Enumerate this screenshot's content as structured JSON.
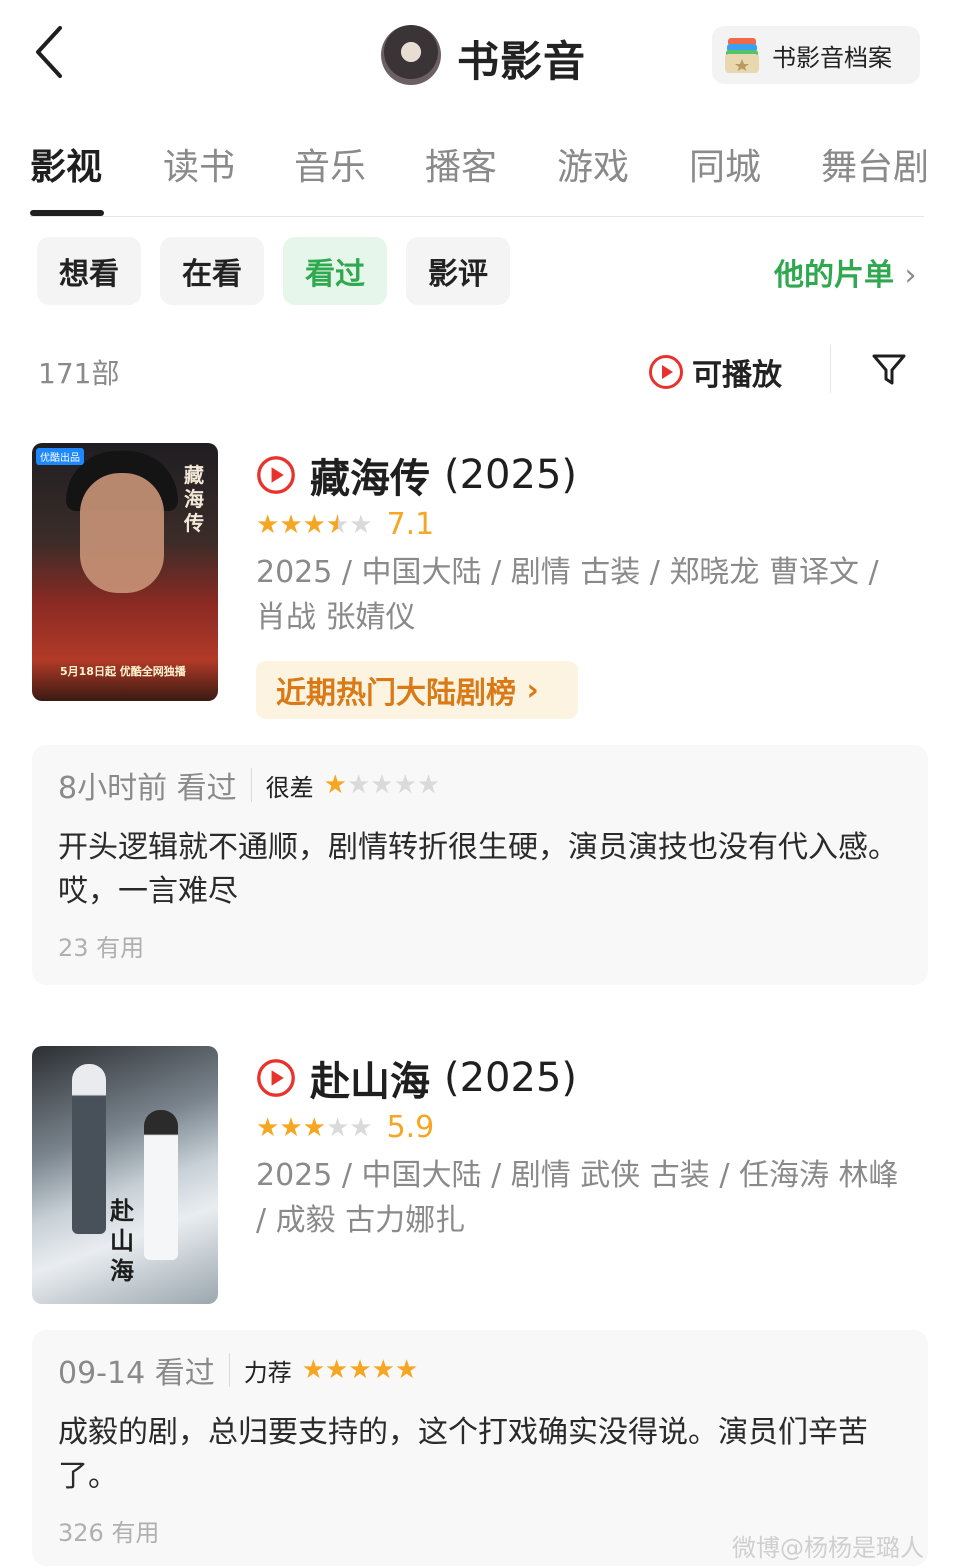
{
  "header": {
    "back_icon": "chevron-left-icon",
    "title": "书影音",
    "archive_button": "书影音档案"
  },
  "tabs": [
    {
      "label": "影视",
      "active": true
    },
    {
      "label": "读书",
      "active": false
    },
    {
      "label": "音乐",
      "active": false
    },
    {
      "label": "播客",
      "active": false
    },
    {
      "label": "游戏",
      "active": false
    },
    {
      "label": "同城",
      "active": false
    },
    {
      "label": "舞台剧",
      "active": false
    }
  ],
  "filters": [
    {
      "label": "想看",
      "active": false
    },
    {
      "label": "在看",
      "active": false
    },
    {
      "label": "看过",
      "active": true
    },
    {
      "label": "影评",
      "active": false
    }
  ],
  "playlist_link": "他的片单",
  "count": "171部",
  "playable_label": "可播放",
  "colors": {
    "accent_green": "#2fa84f",
    "star_orange": "#f5a623",
    "play_red": "#e8332d"
  },
  "movies": [
    {
      "title": "藏海传",
      "year": "(2025)",
      "rating_stars": 3.5,
      "score": "7.1",
      "meta": "2025 / 中国大陆 / 剧情 古装 / 郑晓龙 曹译文 / 肖战 张婧仪",
      "rank_tag": "近期热门大陆剧榜",
      "poster": {
        "badge": "优酷出品",
        "vertical_title": "藏海传",
        "date_text": "5月18日起 优酷全网独播"
      },
      "review": {
        "time": "8小时前 看过",
        "level": "很差",
        "stars": 1,
        "text": "开头逻辑就不通顺，剧情转折很生硬，演员演技也没有代入感。哎，一言难尽",
        "useful": "23 有用"
      }
    },
    {
      "title": "赴山海",
      "year": "(2025)",
      "rating_stars": 3,
      "score": "5.9",
      "meta": "2025 / 中国大陆 / 剧情 武侠 古装 / 任海涛 林峰 / 成毅 古力娜扎",
      "poster": {
        "vertical_title": "赴山海"
      },
      "review": {
        "time": "09-14 看过",
        "level": "力荐",
        "stars": 5,
        "text": "成毅的剧，总归要支持的，这个打戏确实没得说。演员们辛苦了。",
        "useful": "326 有用"
      }
    }
  ],
  "watermark": "微博@杨杨是璐人"
}
